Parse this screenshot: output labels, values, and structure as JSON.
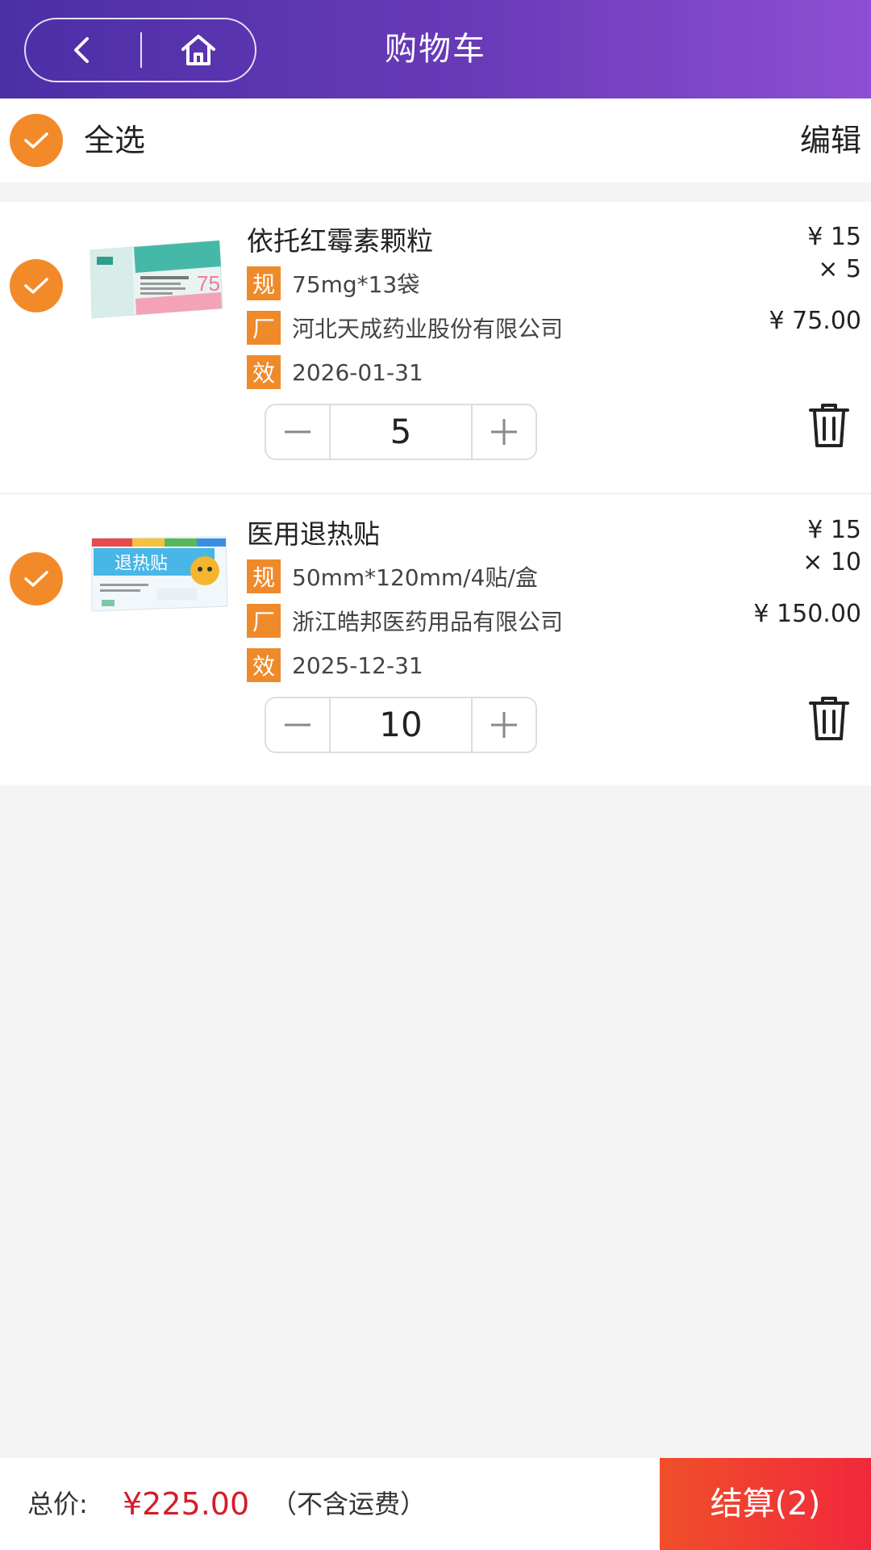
{
  "header": {
    "title": "购物车",
    "back_icon": "chevron-left-icon",
    "home_icon": "home-icon"
  },
  "select_bar": {
    "select_all_label": "全选",
    "edit_label": "编辑",
    "checked": true
  },
  "items": [
    {
      "checked": true,
      "name": "依托红霉素颗粒",
      "spec_tag": "规",
      "spec": "75mg*13袋",
      "mfr_tag": "厂",
      "manufacturer": "河北天成药业股份有限公司",
      "exp_tag": "效",
      "expiry": "2026-01-31",
      "unit_price": "¥ 15",
      "qty_mult": "× 5",
      "line_total": "¥ 75.00",
      "quantity": "5"
    },
    {
      "checked": true,
      "name": "医用退热贴",
      "spec_tag": "规",
      "spec": "50mm*120mm/4贴/盒",
      "mfr_tag": "厂",
      "manufacturer": "浙江皓邦医药用品有限公司",
      "exp_tag": "效",
      "expiry": "2025-12-31",
      "unit_price": "¥ 15",
      "qty_mult": "× 10",
      "line_total": "¥ 150.00",
      "quantity": "10"
    }
  ],
  "footer": {
    "total_label": "总价:",
    "total_value": "¥225.00",
    "total_note": "（不含运费）",
    "checkout_label": "结算(2)"
  },
  "colors": {
    "header_start": "#4b2fa6",
    "header_end": "#8d4fd3",
    "accent_orange": "#f28a2a",
    "price_red": "#d41c2a",
    "checkout_red": "#f1283c"
  }
}
